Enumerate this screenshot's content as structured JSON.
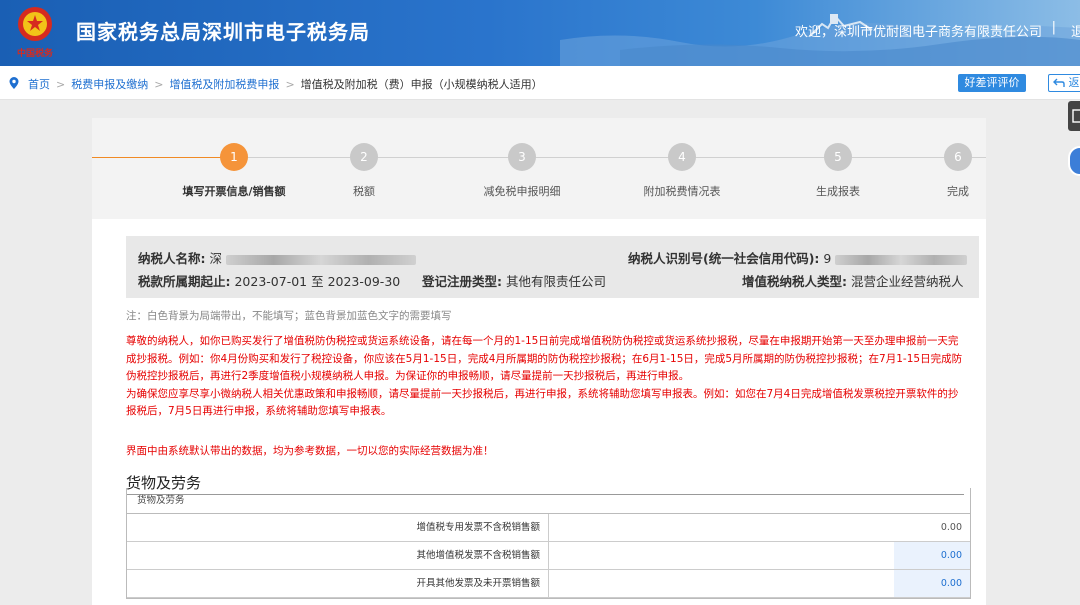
{
  "header": {
    "site_title": "国家税务总局深圳市电子税务局",
    "welcome": "欢迎，深圳市优耐图电子商务有限责任公司",
    "separator": "|",
    "extra": "退"
  },
  "breadcrumb": {
    "items": [
      "首页",
      "税费申报及缴纳",
      "增值税及附加税费申报"
    ],
    "current": "增值税及附加税（费）申报（小规模纳税人适用）",
    "eval_label": "好差评评价",
    "back_label": "返"
  },
  "steps": [
    {
      "num": "1",
      "label": "填写开票信息/销售额",
      "active": true
    },
    {
      "num": "2",
      "label": "税额"
    },
    {
      "num": "3",
      "label": "减免税申报明细"
    },
    {
      "num": "4",
      "label": "附加税费情况表"
    },
    {
      "num": "5",
      "label": "生成报表"
    },
    {
      "num": "6",
      "label": "完成"
    }
  ],
  "info": {
    "taxpayer_name_label": "纳税人名称:",
    "taxpayer_name_prefix": "深",
    "taxpayer_id_label": "纳税人识别号(统一社会信用代码):",
    "taxpayer_id_prefix": "9",
    "period_label": "税款所属期起止:",
    "period_value": "2023-07-01 至 2023-09-30",
    "reg_type_label": "登记注册类型:",
    "reg_type_value": "其他有限责任公司",
    "vat_type_label": "增值税纳税人类型:",
    "vat_type_value": "混营企业经营纳税人"
  },
  "notes": {
    "gray": "注：白色背景为局端带出，不能填写；蓝色背景加蓝色文字的需要填写",
    "red_lines": [
      "尊敬的纳税人，如你已购买发行了增值税防伪税控或货运系统设备，请在每一个月的1-15日前完成增值税防伪税控或货运系统抄报税，尽量在申报期开始第一天至办理申报前一天完",
      "成抄报税。例如：你4月份购买和发行了税控设备，你应该在5月1-15日，完成4月所属期的防伪税控抄报税；在6月1-15日，完成5月所属期的防伪税控抄报税；在7月1-15日完成防",
      "伪税控抄报税后，再进行2季度增值税小规模纳税人申报。为保证你的申报畅顺，请尽量提前一天抄报税后，再进行申报。",
      "为确保您应享尽享小微纳税人相关优惠政策和申报畅顺，请尽量提前一天抄报税后，再进行申报，系统将辅助您填写申报表。例如：如您在7月4日完成增值税发票税控开票软件的抄",
      "报税后，7月5日再进行申报，系统将辅助您填写申报表。"
    ],
    "red2": "界面中由系统默认带出的数据，均为参考数据，一切以您的实际经营数据为准！"
  },
  "goods": {
    "section_title": "货物及劳务",
    "caption": "货物及劳务",
    "rows": [
      {
        "label": "增值税专用发票不含税销售额",
        "value": "0.00",
        "editable": false
      },
      {
        "label": "其他增值税发票不含税销售额",
        "value": "0.00",
        "editable": true
      },
      {
        "label": "开具其他发票及未开票销售额",
        "value": "0.00",
        "editable": true
      }
    ]
  },
  "colors": {
    "header_blue": "#1a5fb4",
    "link_blue": "#1e6fd0",
    "step_active": "#f5943a",
    "step_inactive": "#c9c9c9",
    "warning_red": "#e60000"
  },
  "icons": [
    "tax-emblem-icon",
    "location-pin-icon",
    "back-arrow-icon",
    "chat-icon",
    "avatar-icon"
  ]
}
